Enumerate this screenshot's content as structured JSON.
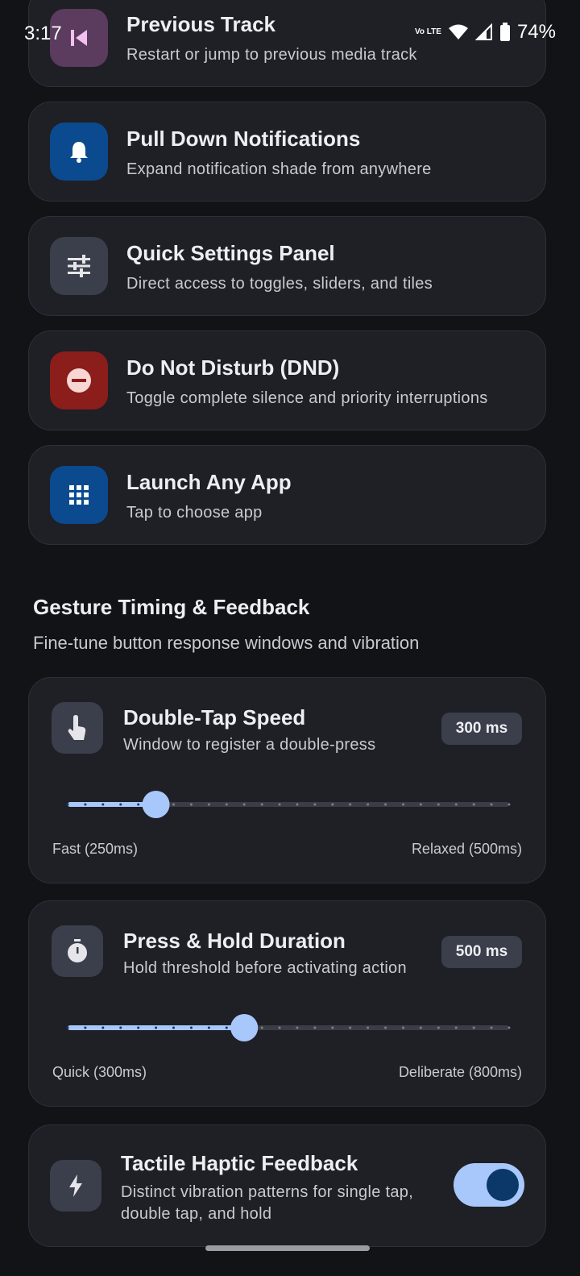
{
  "status_bar": {
    "time": "3:17",
    "network": "Vo LTE",
    "battery": "74%"
  },
  "actions": [
    {
      "title": "Previous Track",
      "subtitle": "Restart or jump to previous media track",
      "icon": "skip-previous-icon",
      "color": "#5b3b5e"
    },
    {
      "title": "Pull Down Notifications",
      "subtitle": "Expand notification shade from anywhere",
      "icon": "bell-icon",
      "color": "#0b4a8f"
    },
    {
      "title": "Quick Settings Panel",
      "subtitle": "Direct access to toggles, sliders, and tiles",
      "icon": "tune-icon",
      "color": "#3a3f4b"
    },
    {
      "title": "Do Not Disturb (DND)",
      "subtitle": "Toggle complete silence and priority interruptions",
      "icon": "do-not-disturb-icon",
      "color": "#8b1d1a"
    },
    {
      "title": "Launch Any App",
      "subtitle": "Tap to choose app",
      "icon": "apps-grid-icon",
      "color": "#0b4a8f"
    }
  ],
  "section": {
    "title": "Gesture Timing & Feedback",
    "subtitle": "Fine-tune button response windows and vibration"
  },
  "double_tap": {
    "title": "Double-Tap Speed",
    "subtitle": "Window to register a double-press",
    "badge": "300 ms",
    "min_label": "Fast (250ms)",
    "max_label": "Relaxed (500ms)",
    "min": 250,
    "max": 500,
    "value": 300
  },
  "press_hold": {
    "title": "Press & Hold Duration",
    "subtitle": "Hold threshold before activating action",
    "badge": "500 ms",
    "min_label": "Quick (300ms)",
    "max_label": "Deliberate (800ms)",
    "min": 300,
    "max": 800,
    "value": 500
  },
  "haptic": {
    "title": "Tactile Haptic Feedback",
    "subtitle_line1": "Distinct vibration patterns for single tap,",
    "subtitle_line2": "double tap, and hold",
    "enabled": true
  },
  "colors": {
    "accent": "#a8c7fa",
    "card": "#1e2026",
    "background": "#121317"
  }
}
